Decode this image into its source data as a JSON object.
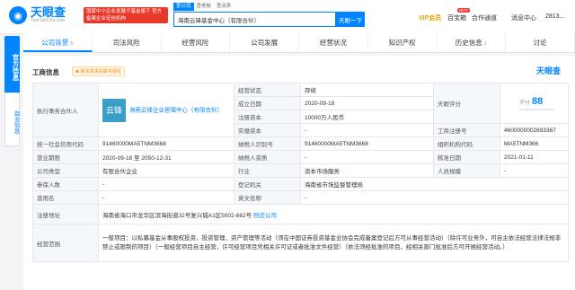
{
  "header": {
    "logo_name": "天眼查",
    "logo_url": "TianYanCha.com",
    "promo_text": "国家中小企业发展子基金旗下 官方备案企业征信机构",
    "search_tabs": [
      "查公司",
      "查老板",
      "查关系"
    ],
    "search_value": "海南云锋基金中心（有限合伙）",
    "search_button": "天眼一下",
    "nav": {
      "vip": "VIP会员",
      "baixiang": "百宝箱",
      "hot": "HOT",
      "cooperation": "合作通道",
      "messages": "消息中心",
      "user": "2813..."
    }
  },
  "sidebar": {
    "official": "官方信息",
    "self": "自主信息"
  },
  "tabs": [
    {
      "label": "公司背景",
      "count": "5"
    },
    {
      "label": "司法风险",
      "count": ""
    },
    {
      "label": "经营风险",
      "count": ""
    },
    {
      "label": "公司发展",
      "count": ""
    },
    {
      "label": "经营状况",
      "count": ""
    },
    {
      "label": "知识产权",
      "count": ""
    },
    {
      "label": "历史信息",
      "count": "1"
    },
    {
      "label": "讨论",
      "count": ""
    }
  ],
  "card": {
    "title": "工商信息",
    "pill": "◉ 股东变更关联可视化",
    "brand": "天眼查"
  },
  "info": {
    "partner_label": "执行事务合伙人",
    "partner_avatar": "云锋",
    "partner_name": "海南云锋企业管理中心（有限合伙）",
    "status_label": "经营状态",
    "status": "存续",
    "established_label": "成立日期",
    "established": "2020-09-18",
    "regcap_label": "注册资本",
    "regcap": "10000万人民币",
    "paidcap_label": "实缴资本",
    "paidcap": "-",
    "score_label": "天眼评分",
    "score_caption": "评分",
    "score": "88",
    "bizno_label": "工商注册号",
    "bizno": "460000000269336​7",
    "credit_label": "统一社会信用代码",
    "credit": "91460000MA5TNM3668",
    "taxid_label": "纳税人识别号",
    "taxid": "91460000MA5TNM3668",
    "orgcode_label": "组织机构代码",
    "orgcode": "MA5TNM366",
    "term_label": "营业期限",
    "term": "2020-09-18 至 2050-12-31",
    "taxqual_label": "纳税人资质",
    "taxqual": "-",
    "approved_label": "核准日期",
    "approved": "2021-01-11",
    "type_label": "公司类型",
    "type": "有限合伙企业",
    "industry_label": "行业",
    "industry": "资本市场服务",
    "staff_label": "人员规模",
    "staff": "-",
    "insured_label": "参保人数",
    "insured": "-",
    "authority_label": "登记机关",
    "authority": "海南省市场监督管理局",
    "former_label": "曾用名",
    "former": "-",
    "english_label": "英文名称",
    "english": "-",
    "addr_label": "注册地址",
    "addr": "海南省海口市龙华区滨海街道32号复兴城A1区5002-662号",
    "addr_link": "附近公司",
    "scope_label": "经营范围",
    "scope": "一般项目：以私募基金从事股权投资、投资管理、资产管理等活动（须在中国证券投资基金业协会完成备案登记后方可从事经营活动）（除许可业务外，可自主依法经营法律法规非禁止或限制的项目）（一般经营项目自主经营，许可经营项目凭相关许可证或者批准文件经营）（依法须经批准的项目，经相关部门批准后方可开展经营活动。）"
  }
}
